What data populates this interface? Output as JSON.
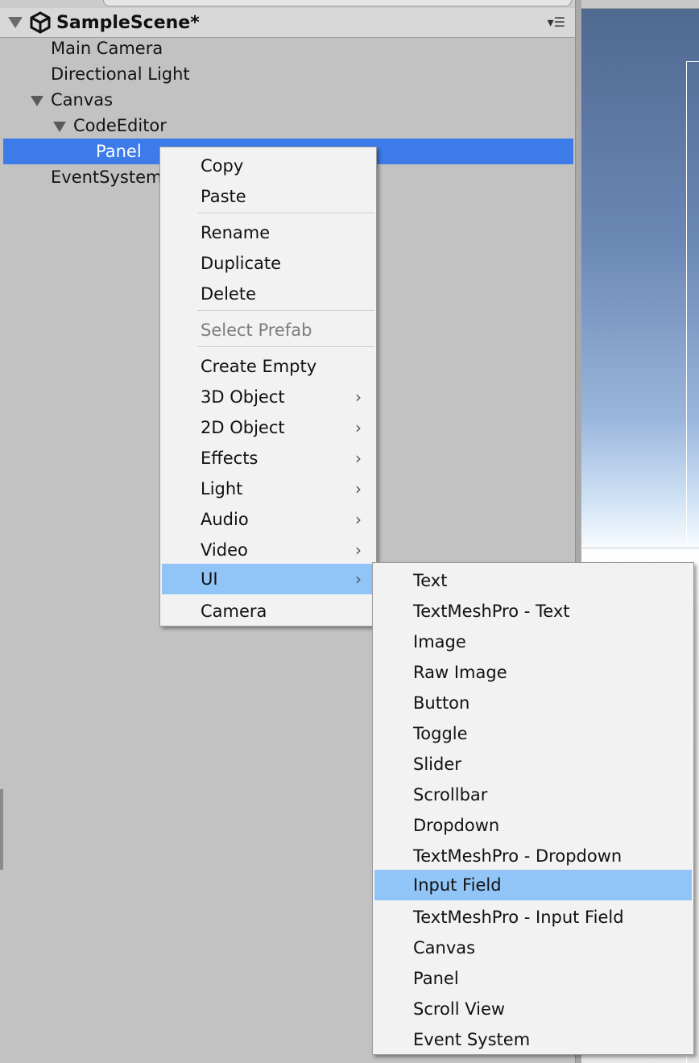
{
  "hierarchy": {
    "scene_title": "SampleScene*",
    "menu_icon": "▾☰",
    "items": [
      {
        "label": "Main Camera"
      },
      {
        "label": "Directional Light"
      },
      {
        "label": "Canvas"
      },
      {
        "label": "CodeEditor"
      },
      {
        "label": "Panel",
        "selected": true
      },
      {
        "label": "EventSystem"
      }
    ]
  },
  "context_menu": {
    "items": [
      {
        "label": "Copy"
      },
      {
        "label": "Paste"
      },
      {
        "label": "Rename"
      },
      {
        "label": "Duplicate"
      },
      {
        "label": "Delete"
      },
      {
        "label": "Select Prefab",
        "disabled": true
      },
      {
        "label": "Create Empty"
      },
      {
        "label": "3D Object",
        "submenu": true
      },
      {
        "label": "2D Object",
        "submenu": true
      },
      {
        "label": "Effects",
        "submenu": true
      },
      {
        "label": "Light",
        "submenu": true
      },
      {
        "label": "Audio",
        "submenu": true
      },
      {
        "label": "Video",
        "submenu": true
      },
      {
        "label": "UI",
        "submenu": true,
        "highlighted": true
      },
      {
        "label": "Camera"
      }
    ],
    "chevron": "›"
  },
  "ui_submenu": {
    "items": [
      {
        "label": "Text"
      },
      {
        "label": "TextMeshPro - Text"
      },
      {
        "label": "Image"
      },
      {
        "label": "Raw Image"
      },
      {
        "label": "Button"
      },
      {
        "label": "Toggle"
      },
      {
        "label": "Slider"
      },
      {
        "label": "Scrollbar"
      },
      {
        "label": "Dropdown"
      },
      {
        "label": "TextMeshPro - Dropdown"
      },
      {
        "label": "Input Field",
        "highlighted": true
      },
      {
        "label": "TextMeshPro - Input Field"
      },
      {
        "label": "Canvas"
      },
      {
        "label": "Panel"
      },
      {
        "label": "Scroll View"
      },
      {
        "label": "Event System"
      }
    ]
  },
  "colors": {
    "selection": "#3c7be8",
    "menu_highlight": "#92c5f7",
    "panel_bg": "#c2c2c2",
    "menu_bg": "#f2f2f2"
  }
}
